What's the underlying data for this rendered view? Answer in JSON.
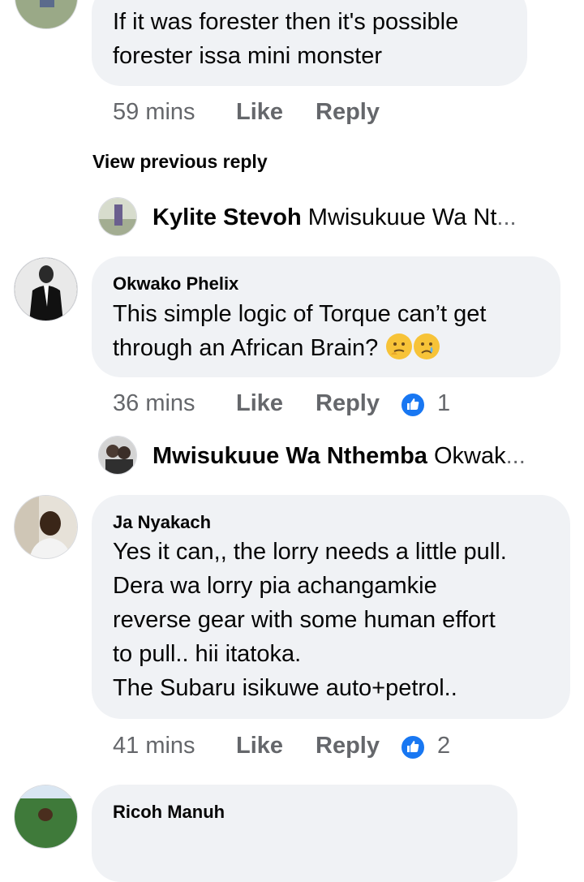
{
  "comment1": {
    "lines": [
      "If it was forester then it's possible",
      "forester issa mini monster"
    ],
    "time": "59 mins",
    "like": "Like",
    "reply": "Reply"
  },
  "view_previous": "View previous reply",
  "reply1": {
    "author": "Kylite Stevoh",
    "preview": "Mwisukuue Wa Nt",
    "ellipsis": "..."
  },
  "comment2": {
    "author": "Okwako Phelix",
    "lines": [
      "This simple logic of Torque can’t get",
      "through an African Brain?"
    ],
    "emojis": [
      "thinking-face-emoji",
      "crying-face-emoji"
    ],
    "time": "36 mins",
    "like": "Like",
    "reply": "Reply",
    "reaction_icon": "thumbs-up-icon",
    "reaction_count": "1"
  },
  "reply2": {
    "author": "Mwisukuue Wa Nthemba",
    "preview": "Okwak",
    "ellipsis": "..."
  },
  "comment3": {
    "author": "Ja Nyakach",
    "lines": [
      "Yes it can,, the lorry needs a little pull.",
      "Dera wa lorry pia achangamkie",
      "reverse gear with some human effort",
      "to pull.. hii itatoka.",
      "The Subaru isikuwe auto+petrol.."
    ],
    "time": "41 mins",
    "like": "Like",
    "reply": "Reply",
    "reaction_icon": "thumbs-up-icon",
    "reaction_count": "2"
  },
  "comment4": {
    "author": "Ricoh Manuh"
  },
  "colors": {
    "bubble": "#f0f2f5",
    "meta": "#65676b",
    "like_blue": "#1877f2"
  }
}
